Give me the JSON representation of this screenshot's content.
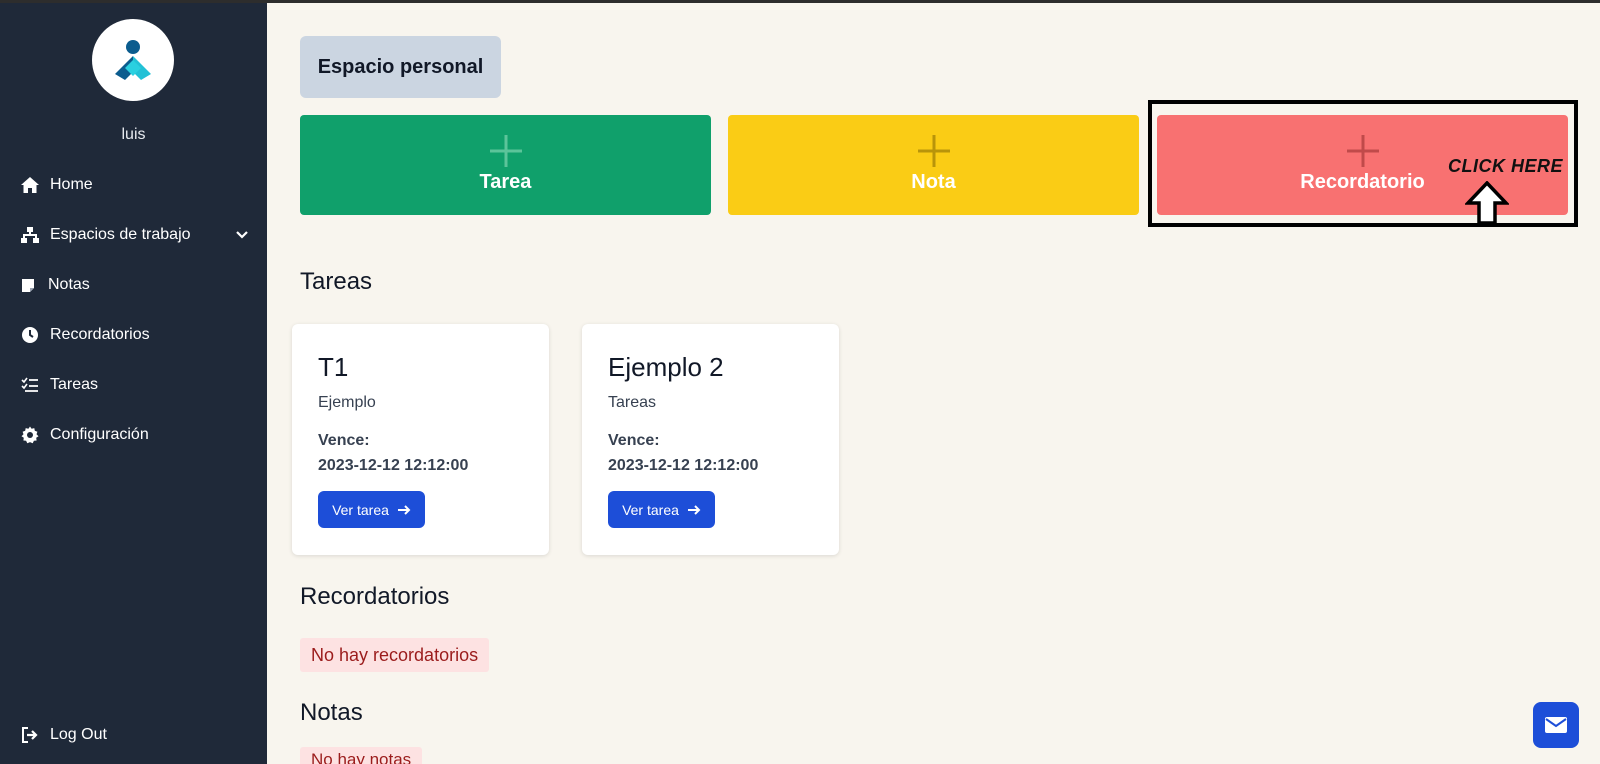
{
  "sidebar": {
    "username": "luis",
    "items": [
      {
        "label": "Home",
        "icon": "home-icon"
      },
      {
        "label": "Espacios de trabajo",
        "icon": "sitemap-icon"
      },
      {
        "label": "Notas",
        "icon": "note-icon"
      },
      {
        "label": "Recordatorios",
        "icon": "clock-icon"
      },
      {
        "label": "Tareas",
        "icon": "checklist-icon"
      },
      {
        "label": "Configuración",
        "icon": "gear-icon"
      }
    ],
    "logout": {
      "label": "Log Out",
      "icon": "logout-icon"
    }
  },
  "workspace": {
    "title": "Espacio personal"
  },
  "create": {
    "tarea": {
      "label": "Tarea",
      "color": "#10a06b"
    },
    "nota": {
      "label": "Nota",
      "color": "#facc15"
    },
    "recordatorio": {
      "label": "Recordatorio",
      "color": "#f87171"
    }
  },
  "annotation": {
    "text": "CLICK HERE"
  },
  "sections": {
    "tareas": "Tareas",
    "recordatorios": "Recordatorios",
    "notas": "Notas"
  },
  "tasks": [
    {
      "title": "T1",
      "description": "Ejemplo",
      "due_label": "Vence:",
      "due": "2023-12-12 12:12:00",
      "button": "Ver tarea"
    },
    {
      "title": "Ejemplo 2",
      "description": "Tareas",
      "due_label": "Vence:",
      "due": "2023-12-12 12:12:00",
      "button": "Ver tarea"
    }
  ],
  "empty": {
    "recordatorios": "No hay recordatorios",
    "notas": "No hay notas"
  },
  "colors": {
    "sidebar": "#1f2939",
    "primary": "#1d4ed8",
    "background": "#f8f5ee"
  }
}
